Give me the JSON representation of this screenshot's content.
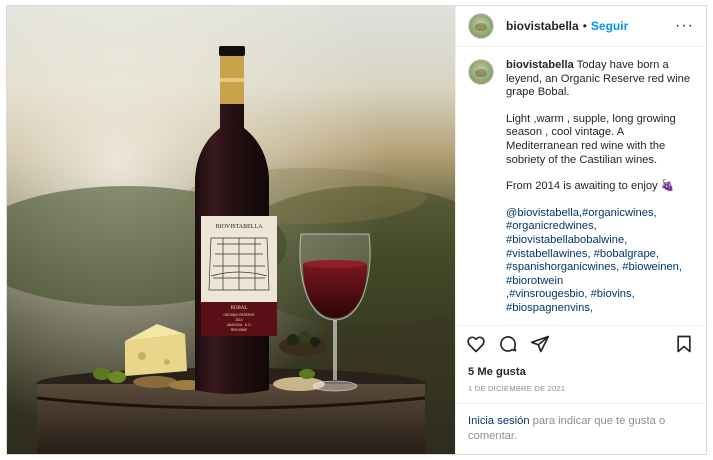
{
  "post": {
    "username": "biovistabella",
    "separator": "•",
    "follow_label": "Seguir",
    "more_label": "···",
    "caption_user": "biovistabella",
    "caption_p1": "Today have born a leyend, an Organic Reserve red wine grape Bobal.",
    "caption_p2": "Light ,warm , supple, long growing season , cool vintage. A Mediterranean red wine with the sobriety of the Castilian wines.",
    "caption_p3": "From 2014 is awaiting to enjoy",
    "caption_emoji": "🍇",
    "hashtags_l1": "@biovistabella,#organicwines,",
    "hashtags_l2": "#organicredwines,",
    "hashtags_l3": "#biovistabellabobalwine,",
    "hashtags_l4": "#vistabellawines, #bobalgrape,",
    "hashtags_l5": "#spanishorganicwines, #bioweinen,",
    "hashtags_l6": "#biorotwein",
    "hashtags_l7": ",#vinsrougesbio, #biovins,",
    "hashtags_l8": "#biospagnenvins,",
    "likes": "5 Me gusta",
    "date": "1 DE DICIEMBRE DE 2021",
    "login_link": "Inicia sesión",
    "login_text": " para indicar que te gusta o comentar."
  },
  "label": {
    "brand": "BIOVISTABELLA",
    "variety": "BOBAL",
    "line1": "ORGANIC RESERVE",
    "line2": "2014",
    "line3": "VALENCIA · D.O.",
    "line4": "RED WINE"
  },
  "icons": [
    "heart-icon",
    "comment-icon",
    "share-icon",
    "bookmark-icon",
    "more-icon"
  ],
  "colors": {
    "link": "#0095f6",
    "hashtag": "#00376b",
    "muted": "#8e8e8e",
    "wine": "#5a0f17"
  }
}
